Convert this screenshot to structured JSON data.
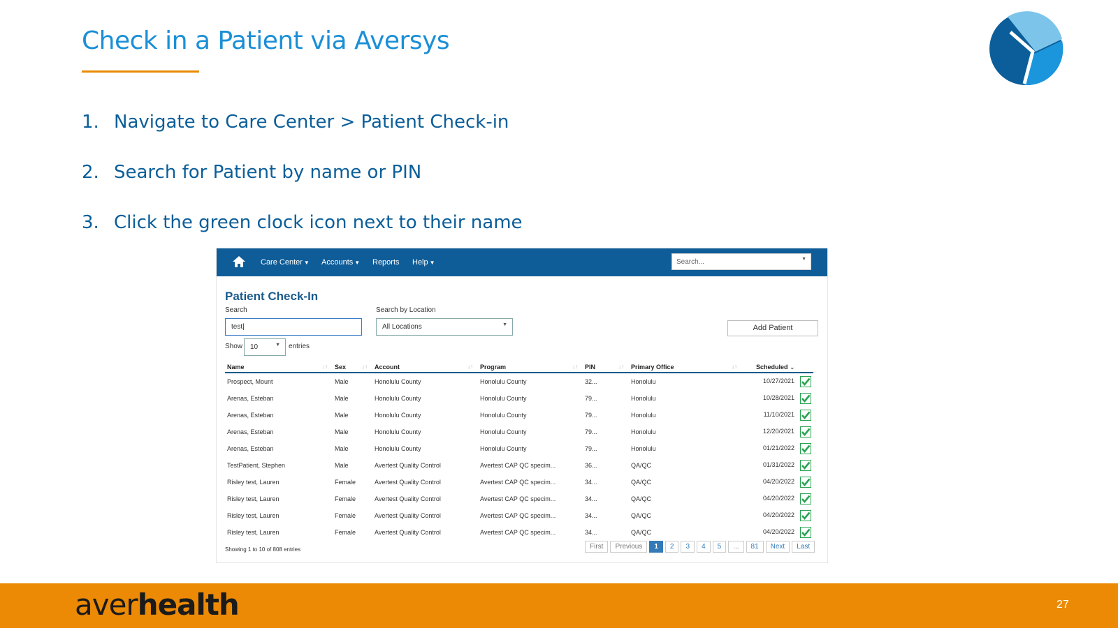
{
  "slide": {
    "title": "Check in a Patient via Aversys",
    "steps": [
      {
        "num": "1.",
        "text": "Navigate to Care Center > Patient Check-in"
      },
      {
        "num": "2.",
        "text": "Search for Patient by name or PIN"
      },
      {
        "num": "3.",
        "text": "Click the green clock icon next to their name"
      }
    ],
    "brand_light": "aver",
    "brand_bold": "health",
    "page_number": "27",
    "colors": {
      "title": "#1a8fd6",
      "accent_rule": "#e98a00",
      "footer": "#ec8a05",
      "navbar": "#0f5d98"
    }
  },
  "app": {
    "nav": {
      "home_icon": "home-icon",
      "care_center": "Care Center",
      "accounts": "Accounts",
      "reports": "Reports",
      "help": "Help",
      "search_placeholder": "Search..."
    },
    "page_title": "Patient Check-In",
    "search_label": "Search",
    "search_value": "test",
    "location_label": "Search by Location",
    "location_value": "All Locations",
    "add_patient": "Add Patient",
    "show_label": "Show",
    "entries_value": "10",
    "entries_label": "entries",
    "columns": [
      "Name",
      "Sex",
      "Account",
      "Program",
      "PIN",
      "Primary Office",
      "Scheduled"
    ],
    "rows": [
      {
        "name": "Prospect, Mount",
        "sex": "Male",
        "account": "Honolulu County",
        "program": "Honolulu County",
        "pin": "32...",
        "office": "Honolulu",
        "scheduled": "10/27/2021"
      },
      {
        "name": "Arenas, Esteban",
        "sex": "Male",
        "account": "Honolulu County",
        "program": "Honolulu County",
        "pin": "79...",
        "office": "Honolulu",
        "scheduled": "10/28/2021"
      },
      {
        "name": "Arenas, Esteban",
        "sex": "Male",
        "account": "Honolulu County",
        "program": "Honolulu County",
        "pin": "79...",
        "office": "Honolulu",
        "scheduled": "11/10/2021"
      },
      {
        "name": "Arenas, Esteban",
        "sex": "Male",
        "account": "Honolulu County",
        "program": "Honolulu County",
        "pin": "79...",
        "office": "Honolulu",
        "scheduled": "12/20/2021"
      },
      {
        "name": "Arenas, Esteban",
        "sex": "Male",
        "account": "Honolulu County",
        "program": "Honolulu County",
        "pin": "79...",
        "office": "Honolulu",
        "scheduled": "01/21/2022"
      },
      {
        "name": "TestPatient, Stephen",
        "sex": "Male",
        "account": "Avertest Quality Control",
        "program": "Avertest CAP QC specim...",
        "pin": "36...",
        "office": "QA/QC",
        "scheduled": "01/31/2022"
      },
      {
        "name": "Risley test, Lauren",
        "sex": "Female",
        "account": "Avertest Quality Control",
        "program": "Avertest CAP QC specim...",
        "pin": "34...",
        "office": "QA/QC",
        "scheduled": "04/20/2022"
      },
      {
        "name": "Risley test, Lauren",
        "sex": "Female",
        "account": "Avertest Quality Control",
        "program": "Avertest CAP QC specim...",
        "pin": "34...",
        "office": "QA/QC",
        "scheduled": "04/20/2022"
      },
      {
        "name": "Risley test, Lauren",
        "sex": "Female",
        "account": "Avertest Quality Control",
        "program": "Avertest CAP QC specim...",
        "pin": "34...",
        "office": "QA/QC",
        "scheduled": "04/20/2022"
      },
      {
        "name": "Risley test, Lauren",
        "sex": "Female",
        "account": "Avertest Quality Control",
        "program": "Avertest CAP QC specim...",
        "pin": "34...",
        "office": "QA/QC",
        "scheduled": "04/20/2022"
      }
    ],
    "info": "Showing 1 to 10 of 808 entries",
    "pagination": [
      "First",
      "Previous",
      "1",
      "2",
      "3",
      "4",
      "5",
      "...",
      "81",
      "Next",
      "Last"
    ],
    "active_page": "1"
  }
}
